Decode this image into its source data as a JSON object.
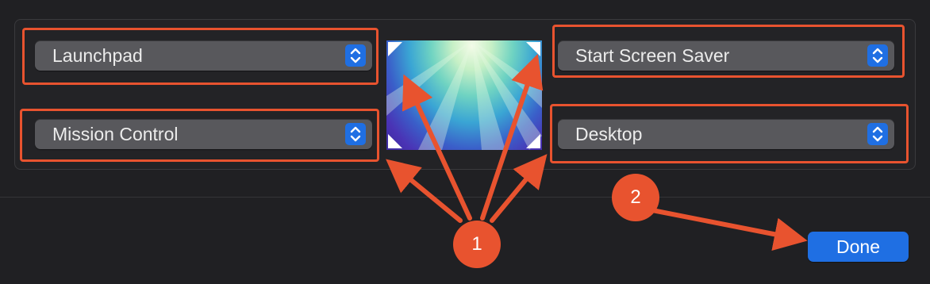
{
  "corners": {
    "top_left": {
      "value": "Launchpad"
    },
    "bottom_left": {
      "value": "Mission Control"
    },
    "top_right": {
      "value": "Start Screen Saver"
    },
    "bottom_right": {
      "value": "Desktop"
    }
  },
  "footer": {
    "done_label": "Done"
  },
  "annotations": {
    "badge_1": "1",
    "badge_2": "2",
    "highlight_color": "#e8532f"
  },
  "colors": {
    "accent": "#1f6fe3",
    "background": "#202023",
    "popup": "#58585c"
  },
  "icons": [
    "chevron-up-down-icon",
    "corner-marker-icon"
  ]
}
